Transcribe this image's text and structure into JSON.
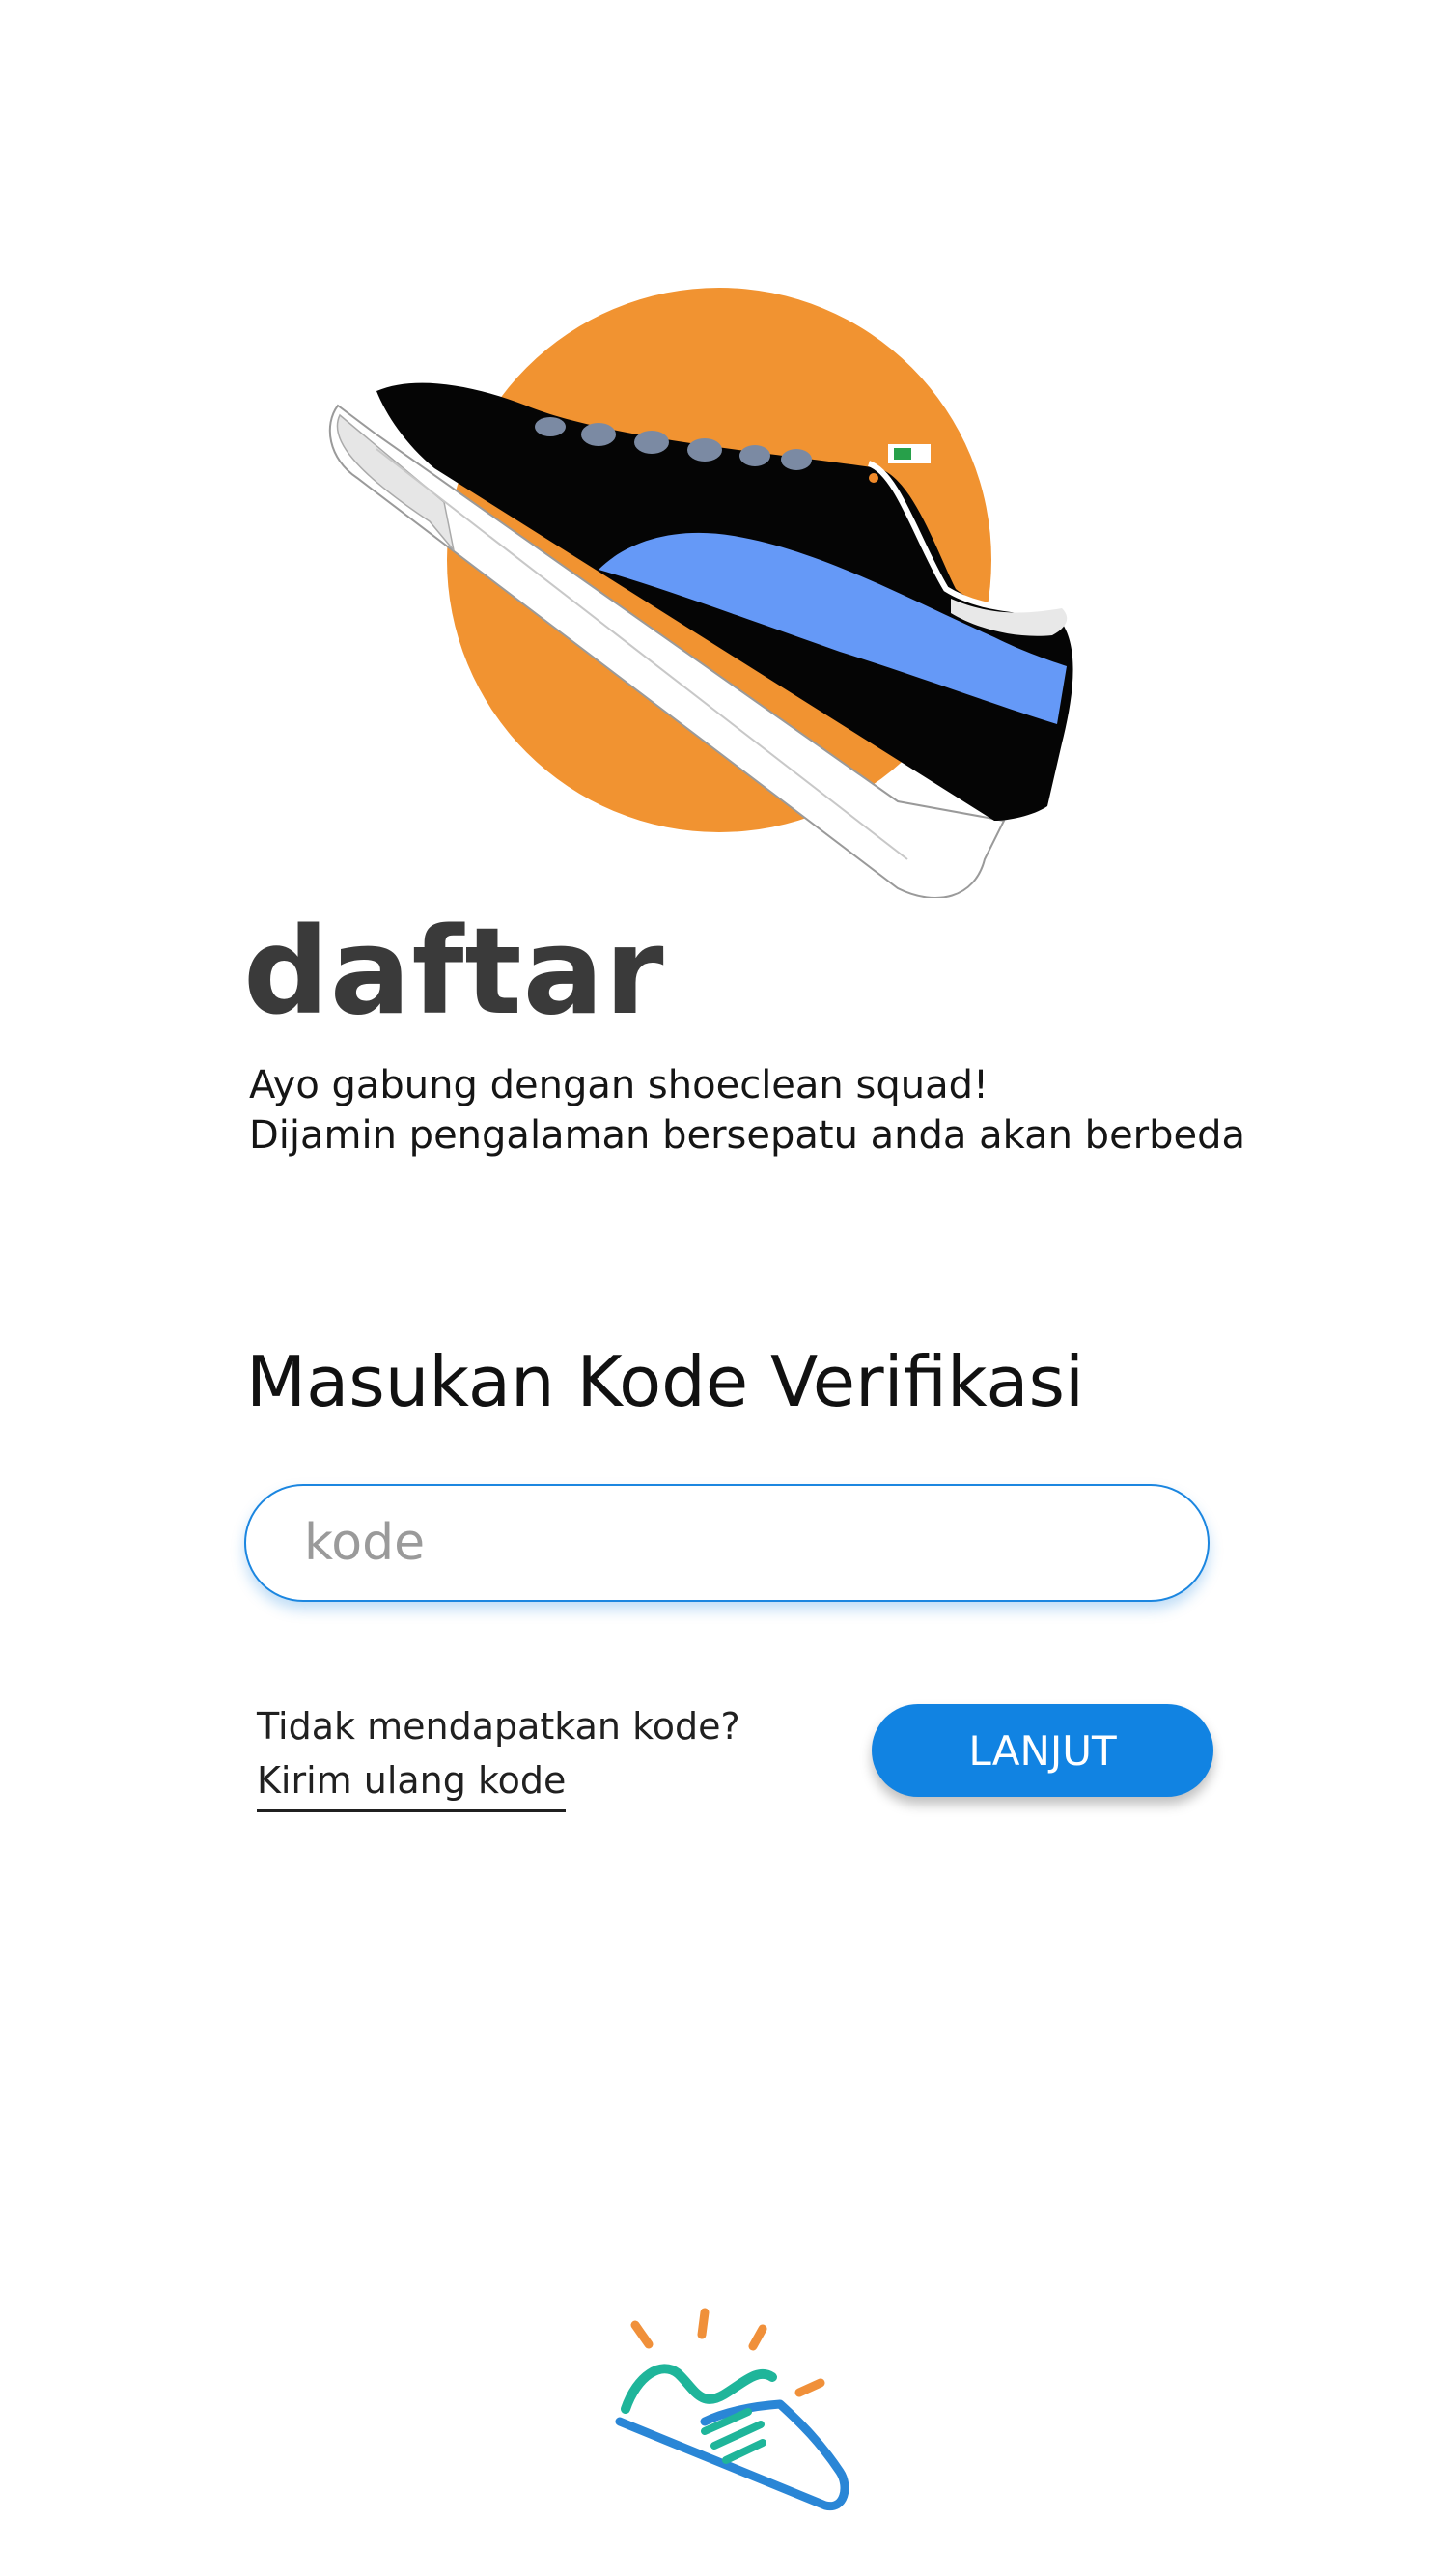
{
  "header": {
    "title": "daftar",
    "subtitle_lines": [
      "Ayo gabung dengan shoeclean squad!",
      "Dijamin pengalaman bersepatu anda akan berbeda"
    ]
  },
  "verification": {
    "heading": "Masukan Kode Verifikasi",
    "input_placeholder": "kode",
    "input_value": "",
    "resend_prompt": "Tidak mendapatkan kode?",
    "resend_link": "Kirim ulang kode",
    "next_label": "LANJUT"
  },
  "icons": {
    "hero": "sneaker-illustration",
    "logo": "shoeclean-logo-icon"
  },
  "colors": {
    "accent": "#1183e2",
    "input_border": "#1b86e0",
    "hero_circle": "#f19331",
    "shoe_stripe": "#6599f7",
    "logo_teal": "#1fb59a",
    "logo_blue": "#2a86d6",
    "logo_orange": "#f0903a",
    "title_text": "#3a3a3a"
  }
}
